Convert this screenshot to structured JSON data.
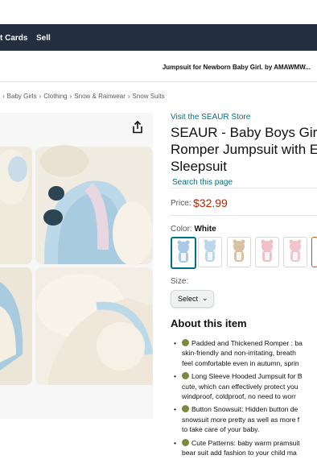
{
  "nav": {
    "gift_cards": "t Cards",
    "sell": "Sell"
  },
  "ad": {
    "text": "Jumpsuit for Newborn Baby Girl. by AMAWMW..."
  },
  "breadcrumb": [
    "Baby Girls",
    "Clothing",
    "Snow & Rainwear",
    "Snow Suits"
  ],
  "product": {
    "store_link": "Visit the SEAUR Store",
    "title_lines": [
      "SEAUR - Baby Boys Girls",
      "Romper Jumpsuit with E",
      "Sleepsuit"
    ],
    "search_page": "Search this page",
    "price_label": "Price:",
    "price": "$32.99",
    "color_label": "Color:",
    "color_value": "White",
    "size_label": "Size:",
    "size_select": "Select",
    "about_heading": "About this item",
    "bullets": [
      [
        "Padded and Thickened Romper : ba",
        "skin-friendly and non-irritating, breath",
        "feel comfortable even in autumn, sprin"
      ],
      [
        "Long Sleeve Hooded Jumpsuit for B",
        "cute, which can effectively protect you",
        "windproof, coldproof, no need to worr"
      ],
      [
        "Button Snowsuit: Hidden button de",
        "snowsuit more pretty as well as more f",
        "to take care of your baby."
      ],
      [
        "Cute Patterns: baby warm pramsuit",
        "bear suit add fashion to your child ma"
      ]
    ]
  },
  "swatch_colors": [
    "#a9c9e6",
    "#bcd6ea",
    "#d9c29f",
    "#f0c0c6",
    "#f2c4cc",
    "#f4e6c8"
  ]
}
